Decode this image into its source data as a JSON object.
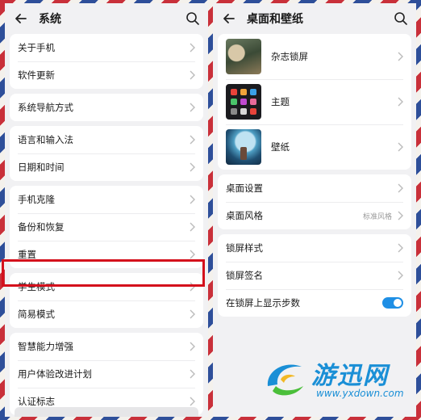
{
  "left": {
    "title": "系统",
    "groups": [
      [
        "关于手机",
        "软件更新"
      ],
      [
        "系统导航方式"
      ],
      [
        "语言和输入法",
        "日期和时间"
      ],
      [
        "手机克隆",
        "备份和恢复",
        "重置"
      ],
      [
        "学生模式",
        "简易模式"
      ],
      [
        "智慧能力增强",
        "用户体验改进计划",
        "认证标志"
      ]
    ]
  },
  "right": {
    "title": "桌面和壁纸",
    "thumbs": [
      "杂志锁屏",
      "主题",
      "壁纸"
    ],
    "desktop_settings": "桌面设置",
    "desktop_style": "桌面风格",
    "desktop_style_value": "标准风格",
    "lock_style": "锁屏样式",
    "lock_signature": "锁屏签名",
    "show_steps": "在锁屏上显示步数",
    "show_steps_on": true
  },
  "watermark": {
    "name": "游迅网",
    "url": "www.yxdown.com"
  },
  "colors": {
    "accent": "#1f8fe5",
    "highlight": "#d4101c"
  }
}
